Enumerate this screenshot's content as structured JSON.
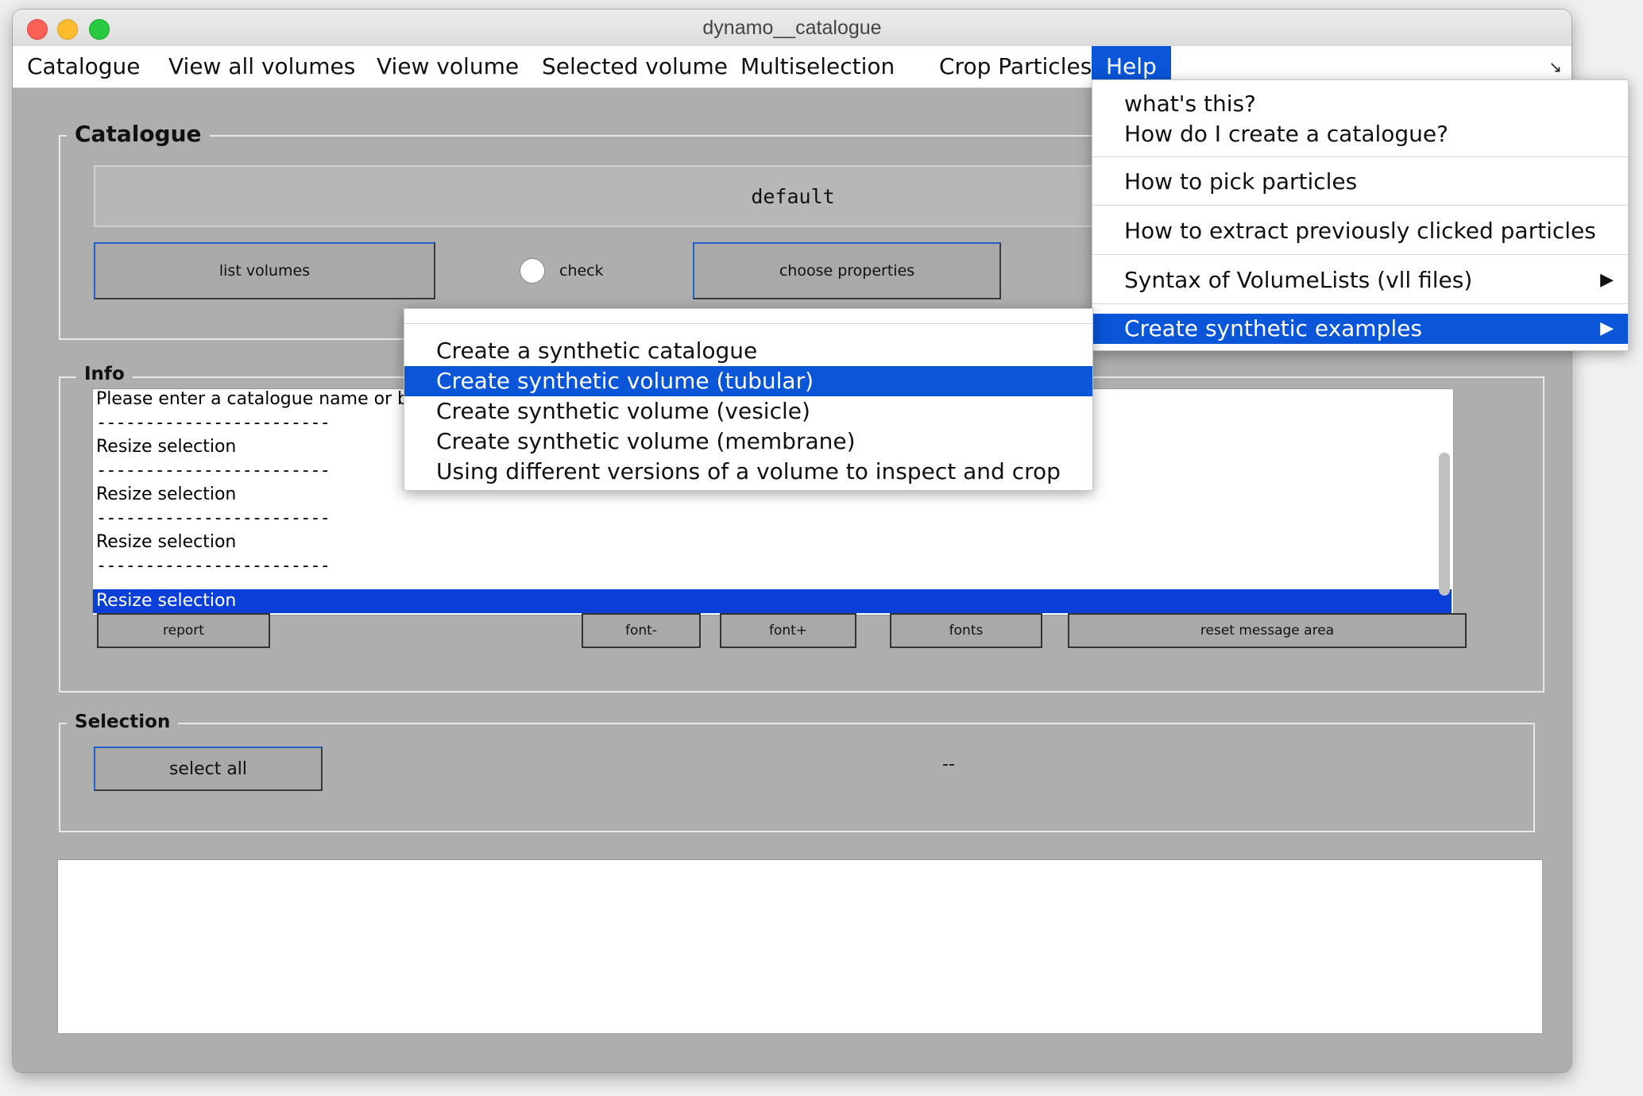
{
  "window": {
    "title": "dynamo__catalogue"
  },
  "menubar": {
    "items": [
      "Catalogue",
      "View all volumes",
      "View volume",
      "Selected volume",
      "Multiselection",
      "Crop Particles",
      "Help"
    ],
    "resize_glyph": "↘"
  },
  "catalogue_panel": {
    "title": "Catalogue",
    "name_value": "default",
    "list_volumes_label": "list volumes",
    "check_label": "check",
    "choose_properties_label": "choose properties"
  },
  "info_panel": {
    "title": "Info",
    "lines": [
      "Please enter a catalogue name or b",
      "------------------------",
      "Resize selection",
      "------------------------",
      "Resize selection",
      "------------------------",
      "Resize selection",
      "------------------------",
      "Resize selection"
    ],
    "buttons": {
      "report": "report",
      "font_minus": "font-",
      "font_plus": "font+",
      "fonts": "fonts",
      "reset": "reset message area"
    }
  },
  "selection_panel": {
    "title": "Selection",
    "select_all_label": "select all",
    "status": "--"
  },
  "help_menu": {
    "items": [
      "what's this?",
      "How do I create a catalogue?",
      "How to pick particles",
      "How to extract previously clicked particles",
      "Syntax of VolumeLists (vll files)",
      "Create synthetic examples"
    ],
    "submenu_arrow": "▶"
  },
  "synthetic_submenu": {
    "items": [
      "Create a synthetic catalogue",
      "Create synthetic volume (tubular)",
      "Create synthetic volume (vesicle)",
      "Create synthetic volume (membrane)",
      "Using different versions of a volume to inspect and crop"
    ],
    "highlighted_index": 1
  },
  "colors": {
    "highlight": "#0a55d8",
    "window_bg": "#aeaeae"
  }
}
